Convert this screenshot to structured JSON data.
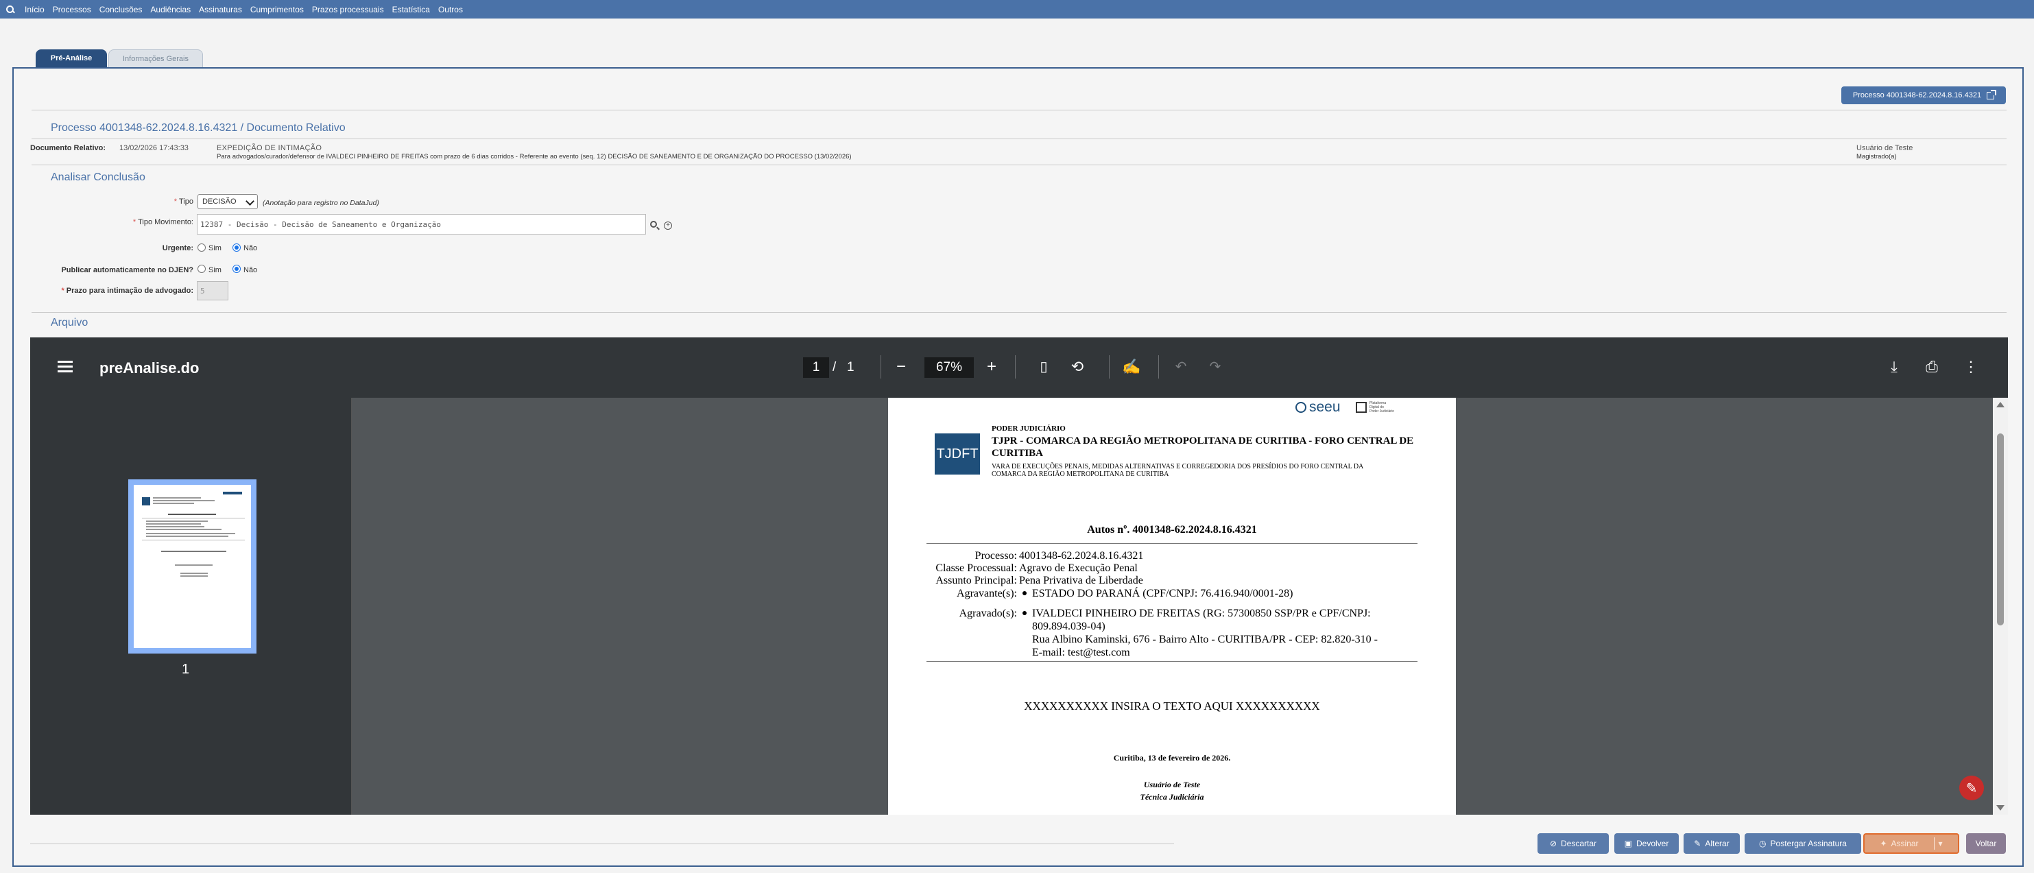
{
  "nav": {
    "items": [
      "Início",
      "Processos",
      "Conclusões",
      "Audiências",
      "Assinaturas",
      "Cumprimentos",
      "Prazos processuais",
      "Estatística",
      "Outros"
    ]
  },
  "tabs": {
    "active": "Pré-Análise",
    "inactive": "Informações Gerais"
  },
  "process_button": "Processo 4001348-62.2024.8.16.4321",
  "header": {
    "title": "Processo 4001348-62.2024.8.16.4321 / Documento Relativo",
    "doc_label": "Documento Relativo:",
    "doc_date": "13/02/2026 17:43:33",
    "doc_type": "EXPEDIÇÃO DE INTIMAÇÃO",
    "doc_desc": "Para advogados/curador/defensor de IVALDECI PINHEIRO DE FREITAS com prazo de 6 dias corridos - Referente ao evento (seq. 12) DECISÃO DE SANEAMENTO E DE ORGANIZAÇÃO DO PROCESSO (13/02/2026)",
    "user_name": "Usuário de Teste",
    "user_role": "Magistrado(a)"
  },
  "analise": {
    "title": "Analisar Conclusão",
    "tipo_label": "Tipo",
    "tipo_value": "DECISÃO",
    "tipo_note": "(Anotação para registro no DataJud)",
    "movimento_label": "Tipo Movimento:",
    "movimento_value": "12387 - Decisão - Decisão de Saneamento e Organização",
    "urgente_label": "Urgente:",
    "djen_label": "Publicar automaticamente no DJEN?",
    "prazo_label": "Prazo para intimação de advogado:",
    "prazo_value": "5",
    "sim": "Sim",
    "nao": "Não"
  },
  "arquivo": {
    "title": "Arquivo"
  },
  "viewer": {
    "filename": "preAnalise.do",
    "page_current": "1",
    "page_sep": "/",
    "page_total": "1",
    "zoom": "67%",
    "thumb_label": "1"
  },
  "doc": {
    "seeu": "seeu",
    "seeu_sub1": "Plataforma",
    "seeu_sub2": "Digital do",
    "seeu_sub3": "Poder Judiciário",
    "logo": "TJDFT",
    "poder": "PODER JUDICIÁRIO",
    "court_line1": "TJPR - COMARCA DA REGIÃO METROPOLITANA DE CURITIBA - FORO CENTRAL DE",
    "court_line2": "CURITIBA",
    "vara_line1": "VARA DE EXECUÇÕES PENAIS, MEDIDAS ALTERNATIVAS E CORREGEDORIA DOS PRESÍDIOS DO FORO CENTRAL DA",
    "vara_line2": "COMARCA DA REGIÃO METROPOLITANA DE CURITIBA",
    "autos": "Autos nº. 4001348-62.2024.8.16.4321",
    "processo_label": "Processo:",
    "processo_value": "4001348-62.2024.8.16.4321",
    "classe_label": "Classe Processual:",
    "classe_value": "Agravo de Execução Penal",
    "assunto_label": "Assunto Principal:",
    "assunto_value": "Pena Privativa de Liberdade",
    "agravante_label": "Agravante(s):",
    "agravante_value": "ESTADO DO PARANÁ (CPF/CNPJ: 76.416.940/0001-28)",
    "agravado_label": "Agravado(s):",
    "agravado_line1": "IVALDECI PINHEIRO DE FREITAS (RG: 57300850 SSP/PR e CPF/CNPJ:",
    "agravado_line2": "809.894.039-04)",
    "agravado_line3": "Rua Albino Kaminski, 676 - Bairro Alto - CURITIBA/PR - CEP: 82.820-310 -",
    "agravado_line4": "E-mail: test@test.com",
    "body": "XXXXXXXXXX INSIRA O TEXTO AQUI XXXXXXXXXX",
    "place_date": "Curitiba, 13 de fevereiro de 2026.",
    "sign_name": "Usuário de Teste",
    "sign_role": "Técnica Judiciária"
  },
  "buttons": {
    "descartar": "Descartar",
    "devolver": "Devolver",
    "alterar": "Alterar",
    "postergar": "Postergar Assinatura",
    "assinar": "Assinar",
    "voltar": "Voltar"
  }
}
